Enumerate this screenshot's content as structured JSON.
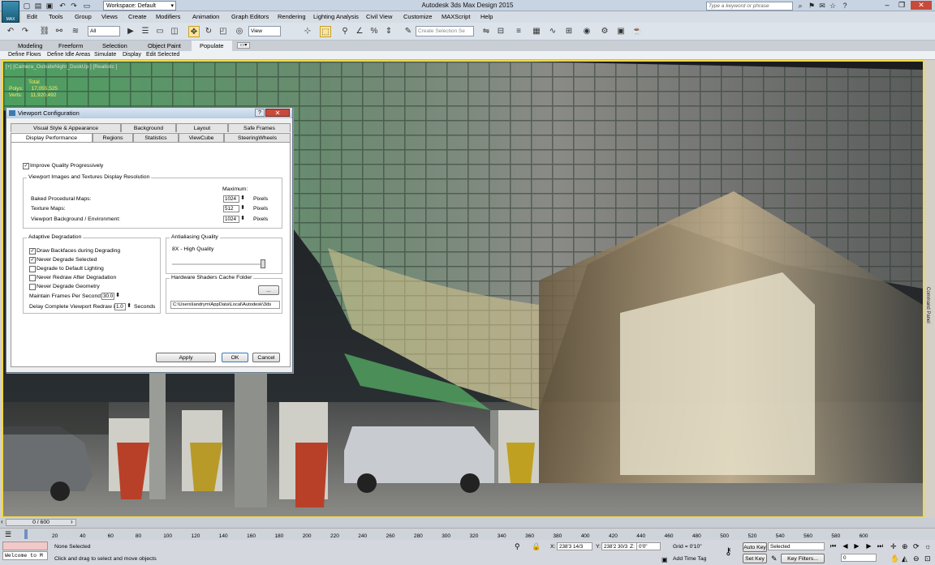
{
  "app": {
    "logo": "MAX",
    "title": "Autodesk 3ds Max Design 2015",
    "workspace": "Workspace: Default",
    "search_placeholder": "Type a keyword or phrase"
  },
  "menu": [
    "Edit",
    "Tools",
    "Group",
    "Views",
    "Create",
    "Modifiers",
    "Animation",
    "Graph Editors",
    "Rendering",
    "Lighting Analysis",
    "Civil View",
    "Customize",
    "MAXScript",
    "Help"
  ],
  "toolbar": {
    "filter": "All",
    "view": "View",
    "selection_set": "Create Selection Se"
  },
  "ribbon": {
    "tabs": [
      "Modeling",
      "Freeform",
      "Selection",
      "Object Paint",
      "Populate"
    ]
  },
  "populate": [
    "Define Flows",
    "Define Idle Areas",
    "Simulate",
    "Display",
    "Edit Selected"
  ],
  "viewport": {
    "label": "[+] [Camera_OutsideNight_DuskUp ] [Realistic ]",
    "stats_title": "Total",
    "polys_label": "Polys:",
    "polys": "17,055,525",
    "verts_label": "Verts:",
    "verts": "11,920,492"
  },
  "cmd_panel": "Command Panel",
  "dialog": {
    "title": "Viewport Configuration",
    "tabs_row1": [
      "Visual Style & Appearance",
      "Background",
      "Layout",
      "Safe Frames"
    ],
    "tabs_row2": [
      "Display Performance",
      "Regions",
      "Statistics",
      "ViewCube",
      "SteeringWheels"
    ],
    "improve": "Improve Quality Progressively",
    "res_group": "Viewport Images and Textures Display Resolution",
    "maximum": "Maximum:",
    "rows": [
      {
        "label": "Baked Procedural Maps:",
        "value": "1024",
        "unit": "Pixels"
      },
      {
        "label": "Texture Maps:",
        "value": "512",
        "unit": "Pixels"
      },
      {
        "label": "Viewport Background / Environment:",
        "value": "1024",
        "unit": "Pixels"
      }
    ],
    "adaptive": "Adaptive Degradation",
    "adaptive_items": [
      {
        "label": "Draw Backfaces during Degrading"
      },
      {
        "label": "Never Degrade Selected"
      },
      {
        "label": "Degrade to Default Lighting"
      },
      {
        "label": "Never Redraw After Degradation"
      },
      {
        "label": "Never Degrade Geometry"
      }
    ],
    "fps_label": "Maintain Frames Per Second:",
    "fps": "30.0",
    "delay_label": "Delay Complete Viewport Redraw in",
    "delay": "1.0",
    "delay_unit": "Seconds",
    "aa_group": "Antialiasing Quality",
    "aa_value": "8X - High Quality",
    "cache_group": "Hardware Shaders Cache Folder",
    "browse": "...",
    "cache_path": "C:\\Users\\landrym\\AppData\\Local\\Autodesk\\3ds",
    "apply": "Apply",
    "ok": "OK",
    "cancel": "Cancel"
  },
  "timeline": {
    "frames": "0 / 600",
    "ticks": [
      "20",
      "40",
      "60",
      "80",
      "100",
      "120",
      "140",
      "160",
      "180",
      "200",
      "220",
      "240",
      "260",
      "280",
      "300",
      "320",
      "340",
      "360",
      "380",
      "400",
      "420",
      "440",
      "460",
      "480",
      "500",
      "520",
      "540",
      "560",
      "580",
      "600"
    ]
  },
  "status": {
    "selection": "None Selected",
    "hint": "Click and drag to select and move objects",
    "prompt": "Welcome to M",
    "x_label": "X:",
    "x": "238'3 14/3",
    "y_label": "Y:",
    "y": "238'2 30/3",
    "z_label": "Z:",
    "z": "0'0\"",
    "grid": "Grid = 0'10\"",
    "add_time_tag": "Add Time Tag",
    "auto_key": "Auto Key",
    "set_key": "Set Key",
    "key_mode": "Selected",
    "key_filters": "Key Filters...",
    "frame": "0"
  }
}
